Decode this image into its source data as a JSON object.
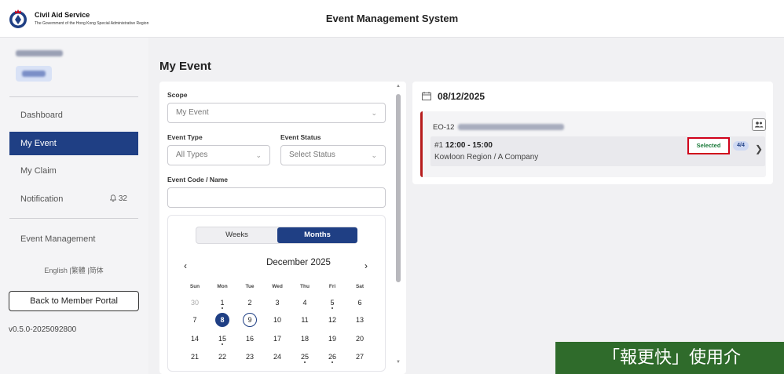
{
  "header": {
    "org_name": "Civil Aid Service",
    "org_sub": "The Government of the Hong Kong Special Administrative Region",
    "app_title": "Event Management System",
    "logo_icon": "cas-crest-icon"
  },
  "sidebar": {
    "nav": [
      {
        "label": "Dashboard"
      },
      {
        "label": "My Event"
      },
      {
        "label": "My Claim"
      },
      {
        "label": "Notification",
        "count": "32"
      },
      {
        "label": "Event Management"
      }
    ],
    "lang": {
      "english": "English",
      "trad": "繁體",
      "simp": "简体",
      "sep": "|"
    },
    "back_button": "Back to Member Portal",
    "version": "v0.5.0-2025092800"
  },
  "main": {
    "page_title": "My Event",
    "filters": {
      "scope_label": "Scope",
      "scope_value": "My Event",
      "type_label": "Event Type",
      "type_value": "All Types",
      "status_label": "Event Status",
      "status_placeholder": "Select Status",
      "code_label": "Event Code / Name",
      "code_value": ""
    },
    "calendar": {
      "weeks_label": "Weeks",
      "months_label": "Months",
      "month_title": "December 2025",
      "prev": "‹",
      "next": "›",
      "weekdays": [
        "Sun",
        "Mon",
        "Tue",
        "Wed",
        "Thu",
        "Fri",
        "Sat"
      ],
      "rows": [
        [
          "30",
          "1",
          "2",
          "3",
          "4",
          "5",
          "6"
        ],
        [
          "7",
          "8",
          "9",
          "10",
          "11",
          "12",
          "13"
        ],
        [
          "14",
          "15",
          "16",
          "17",
          "18",
          "19",
          "20"
        ],
        [
          "21",
          "22",
          "23",
          "24",
          "25",
          "26",
          "27"
        ]
      ],
      "selected_day": "8",
      "today_day": "9"
    },
    "event_list": {
      "date": "08/12/2025",
      "event_code": "EO-12",
      "session_no": "#1",
      "session_time": "12:00 - 15:00",
      "location": "Kowloon Region / A Company",
      "status_badge": "Selected",
      "quota": "4/4"
    }
  },
  "overlay_banner": "「報更快」使用介",
  "colors": {
    "primary": "#1f3f84",
    "accent_red": "#b71c1c",
    "selected_text": "#1b7a3a",
    "banner": "#2f6b2b"
  }
}
